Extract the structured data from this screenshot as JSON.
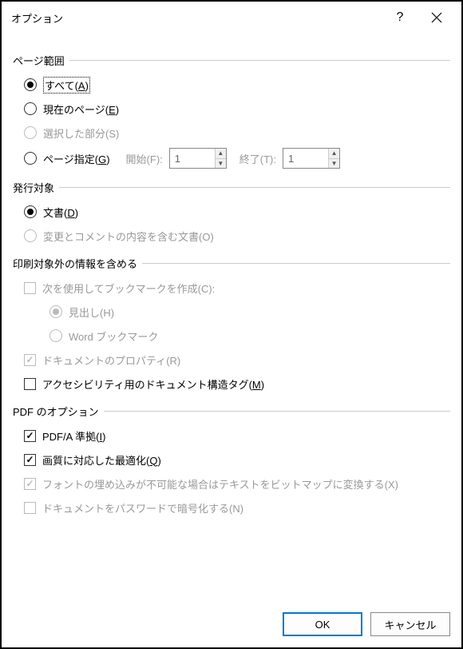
{
  "title": "オプション",
  "groups": {
    "pageRange": {
      "label": "ページ範囲",
      "all_pre": "すべて(",
      "all_key": "A",
      "all_post": ")",
      "current_pre": "現在のページ(",
      "current_key": "E",
      "current_post": ")",
      "selection": "選択した部分(S)",
      "pages_pre": "ページ指定(",
      "pages_key": "G",
      "pages_post": ")",
      "from_label": "開始(F):",
      "from_value": "1",
      "to_label": "終了(T):",
      "to_value": "1"
    },
    "publish": {
      "label": "発行対象",
      "document_pre": "文書(",
      "document_key": "D",
      "document_post": ")",
      "markup": "変更とコメントの内容を含む文書(O)"
    },
    "nonprint": {
      "label": "印刷対象外の情報を含める",
      "bookmarks": "次を使用してブックマークを作成(C):",
      "headings": "見出し(H)",
      "wordbm": "Word ブックマーク",
      "props": "ドキュメントのプロパティ(R)",
      "tags_pre": "アクセシビリティ用のドキュメント構造タグ(",
      "tags_key": "M",
      "tags_post": ")"
    },
    "pdf": {
      "label": "PDF のオプション",
      "pdfa_pre": "PDF/A 準拠(",
      "pdfa_key": "I",
      "pdfa_post": ")",
      "optimize_pre": "画質に対応した最適化(",
      "optimize_key": "Q",
      "optimize_post": ")",
      "bitmap": "フォントの埋め込みが不可能な場合はテキストをビットマップに変換する(X)",
      "encrypt": "ドキュメントをパスワードで暗号化する(N)"
    }
  },
  "buttons": {
    "ok": "OK",
    "cancel": "キャンセル"
  }
}
